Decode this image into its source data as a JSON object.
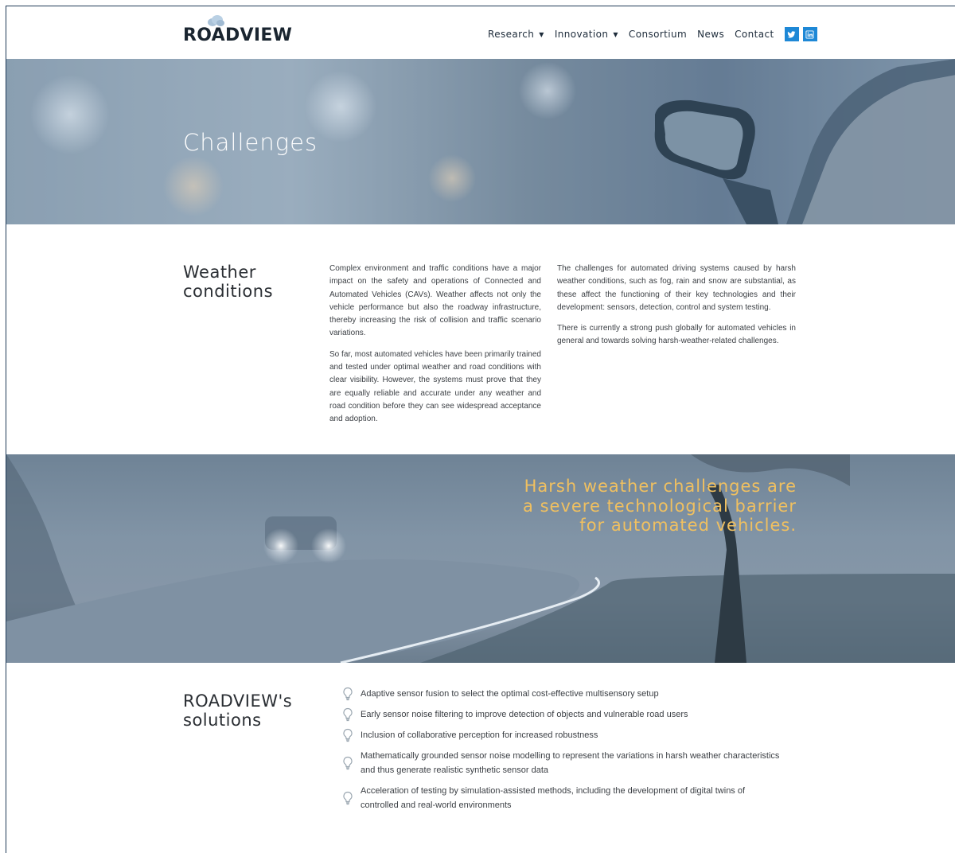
{
  "header": {
    "logo": "ROADVIEW",
    "nav": [
      {
        "label": "Research",
        "dropdown": true
      },
      {
        "label": "Innovation",
        "dropdown": true
      },
      {
        "label": "Consortium",
        "dropdown": false
      },
      {
        "label": "News",
        "dropdown": false
      },
      {
        "label": "Contact",
        "dropdown": false
      }
    ],
    "social": [
      {
        "icon": "twitter-icon"
      },
      {
        "icon": "linkedin-icon"
      }
    ],
    "social_color": "#1e88d6"
  },
  "hero": {
    "title": "Challenges"
  },
  "weather": {
    "title_line1": "Weather",
    "title_line2": "conditions",
    "col1": [
      "Complex environment and traffic conditions have a major impact on the safety and operations of Connected and Automated Vehicles (CAVs). Weather affects not only the vehicle performance but also the roadway infrastructure, thereby increasing the risk of collision and traffic scenario variations.",
      "So far, most automated vehicles have been primarily trained and tested under optimal weather and road conditions with clear visibility. However, the systems must prove that they are equally reliable and accurate under any weather and road condition before they can see widespread acceptance and adoption."
    ],
    "col2": [
      "The challenges for automated driving systems caused by harsh weather conditions, such as fog, rain and snow are substantial, as these affect the functioning of their key technologies and their development: sensors, detection, control and system testing.",
      "There is currently a strong push globally for automated vehicles in general and towards solving harsh-weather-related challenges."
    ]
  },
  "banner": {
    "line1": "Harsh weather challenges are",
    "line2": "a severe technological barrier",
    "line3": "for automated vehicles.",
    "text_color": "#f0c060"
  },
  "solutions": {
    "title_line1": "ROADVIEW's",
    "title_line2": "solutions",
    "items": [
      "Adaptive sensor fusion to select the optimal cost-effective multisensory setup",
      "Early sensor noise filtering to improve detection of objects and vulnerable road users",
      "Inclusion of collaborative perception for increased robustness",
      "Mathematically grounded sensor noise modelling to represent the variations in harsh weather characteristics and thus generate realistic synthetic sensor data",
      "Acceleration of testing by simulation-assisted methods, including the development of digital twins of controlled and real-world environments"
    ],
    "icon": "lightbulb-icon"
  }
}
